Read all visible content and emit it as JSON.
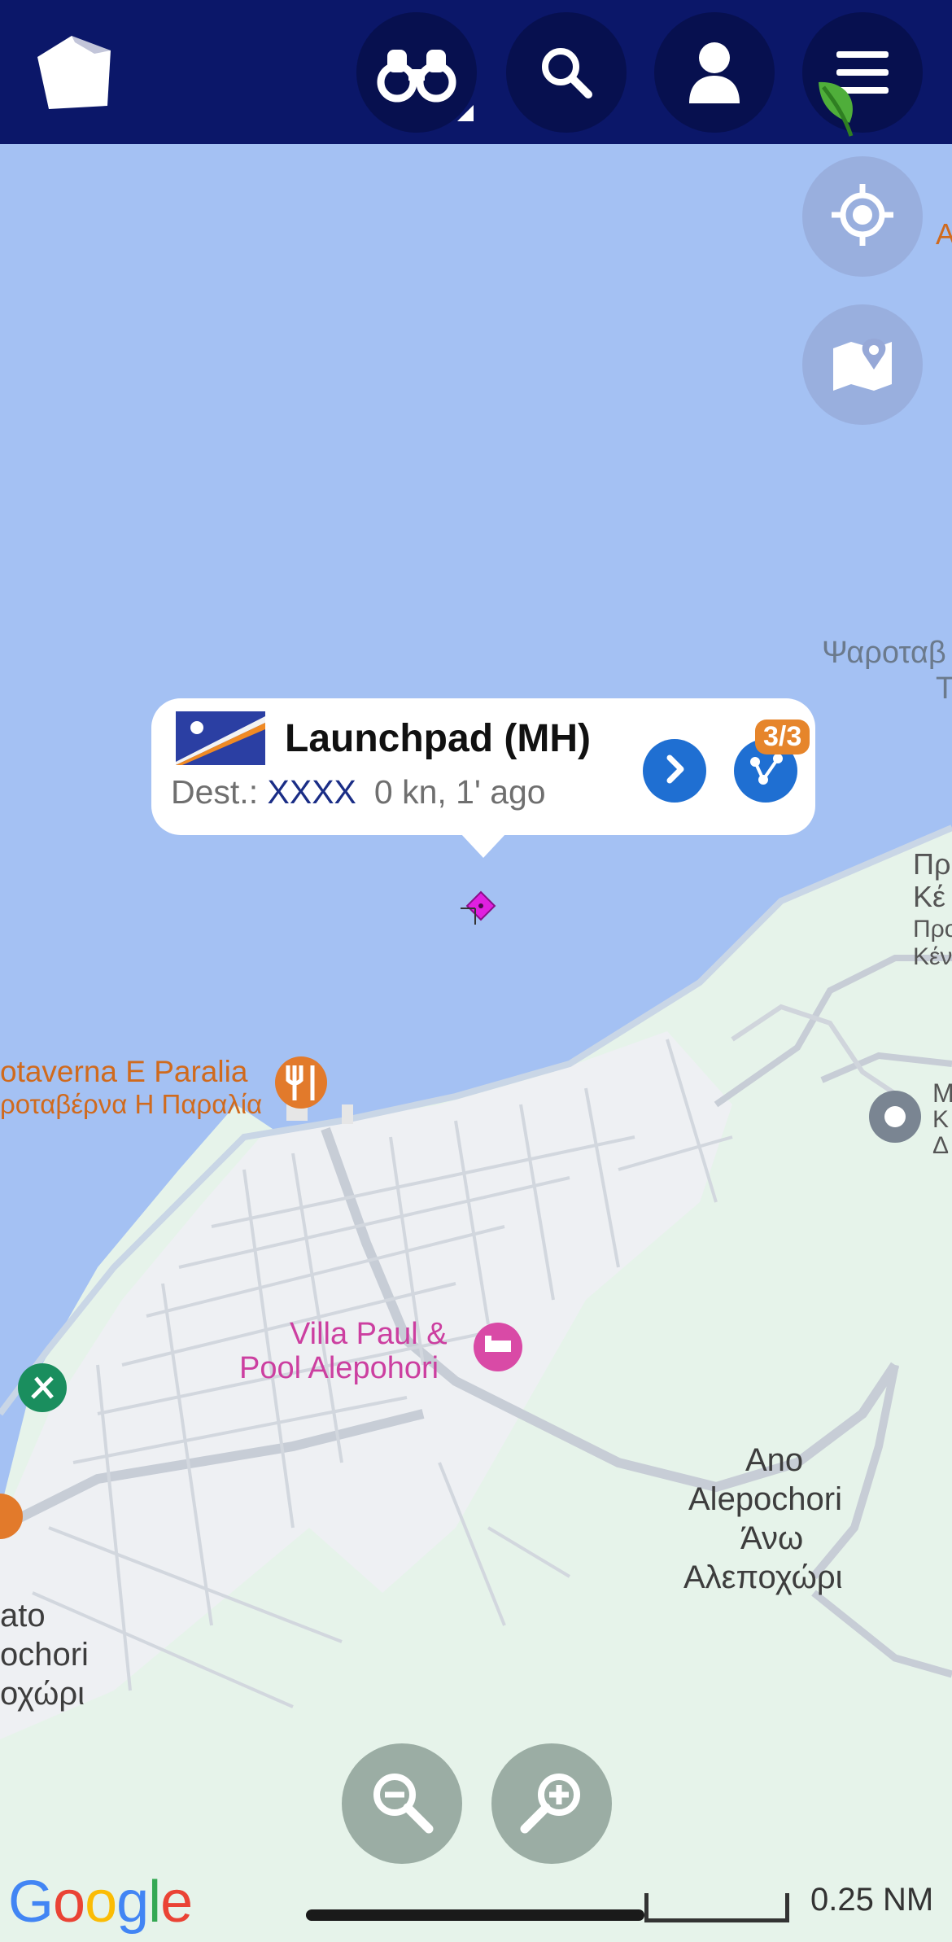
{
  "colors": {
    "topbar": "#0b1769",
    "water": "#a4c1f3",
    "land": "#e6f3ea",
    "accent_blue": "#1f6fd2",
    "badge_orange": "#e6852b",
    "vessel_magenta": "#e020e0"
  },
  "topbar": {
    "logo_icon": "app-logo-icon",
    "buttons": [
      {
        "id": "binoculars",
        "icon": "binoculars-icon"
      },
      {
        "id": "search",
        "icon": "search-icon"
      },
      {
        "id": "account",
        "icon": "user-icon"
      },
      {
        "id": "menu",
        "icon": "hamburger-menu-icon"
      }
    ]
  },
  "map_controls": {
    "locate_icon": "crosshair-icon",
    "layers_icon": "map-pin-icon",
    "zoom_out_icon": "zoom-out-icon",
    "zoom_in_icon": "zoom-in-icon"
  },
  "vessel_popup": {
    "name": "Launchpad (MH)",
    "flag": "Marshall Islands",
    "dest_label": "Dest.:",
    "dest_value": "XXXX",
    "status": "0 kn, 1' ago",
    "count_badge": "3/3"
  },
  "map_labels": {
    "taverna_1": "otaverna E Paralia",
    "taverna_2": "ροταβέρνα Η Παραλία",
    "villa_1": "Villa Paul &",
    "villa_2": "Pool Alepohori",
    "ano_1": "Ano",
    "ano_2": "Alepochori",
    "ano_3": "Άνω",
    "ano_4": "Αλεποχώρι",
    "kato_1": "ato",
    "kato_2": "ochori",
    "kato_3": "οχώρι",
    "psarot_1": "Ψαροταβ",
    "psarot_2": "Τ",
    "right_1": "Πρ",
    "right_2": "Κέ",
    "right_3": "Προ",
    "right_4": "Κέν",
    "m_1": "Μ",
    "m_2": "Κ",
    "m_3": "Δ",
    "edge_a": "Α"
  },
  "attribution": "Google",
  "scale_label": "0.25 NM"
}
